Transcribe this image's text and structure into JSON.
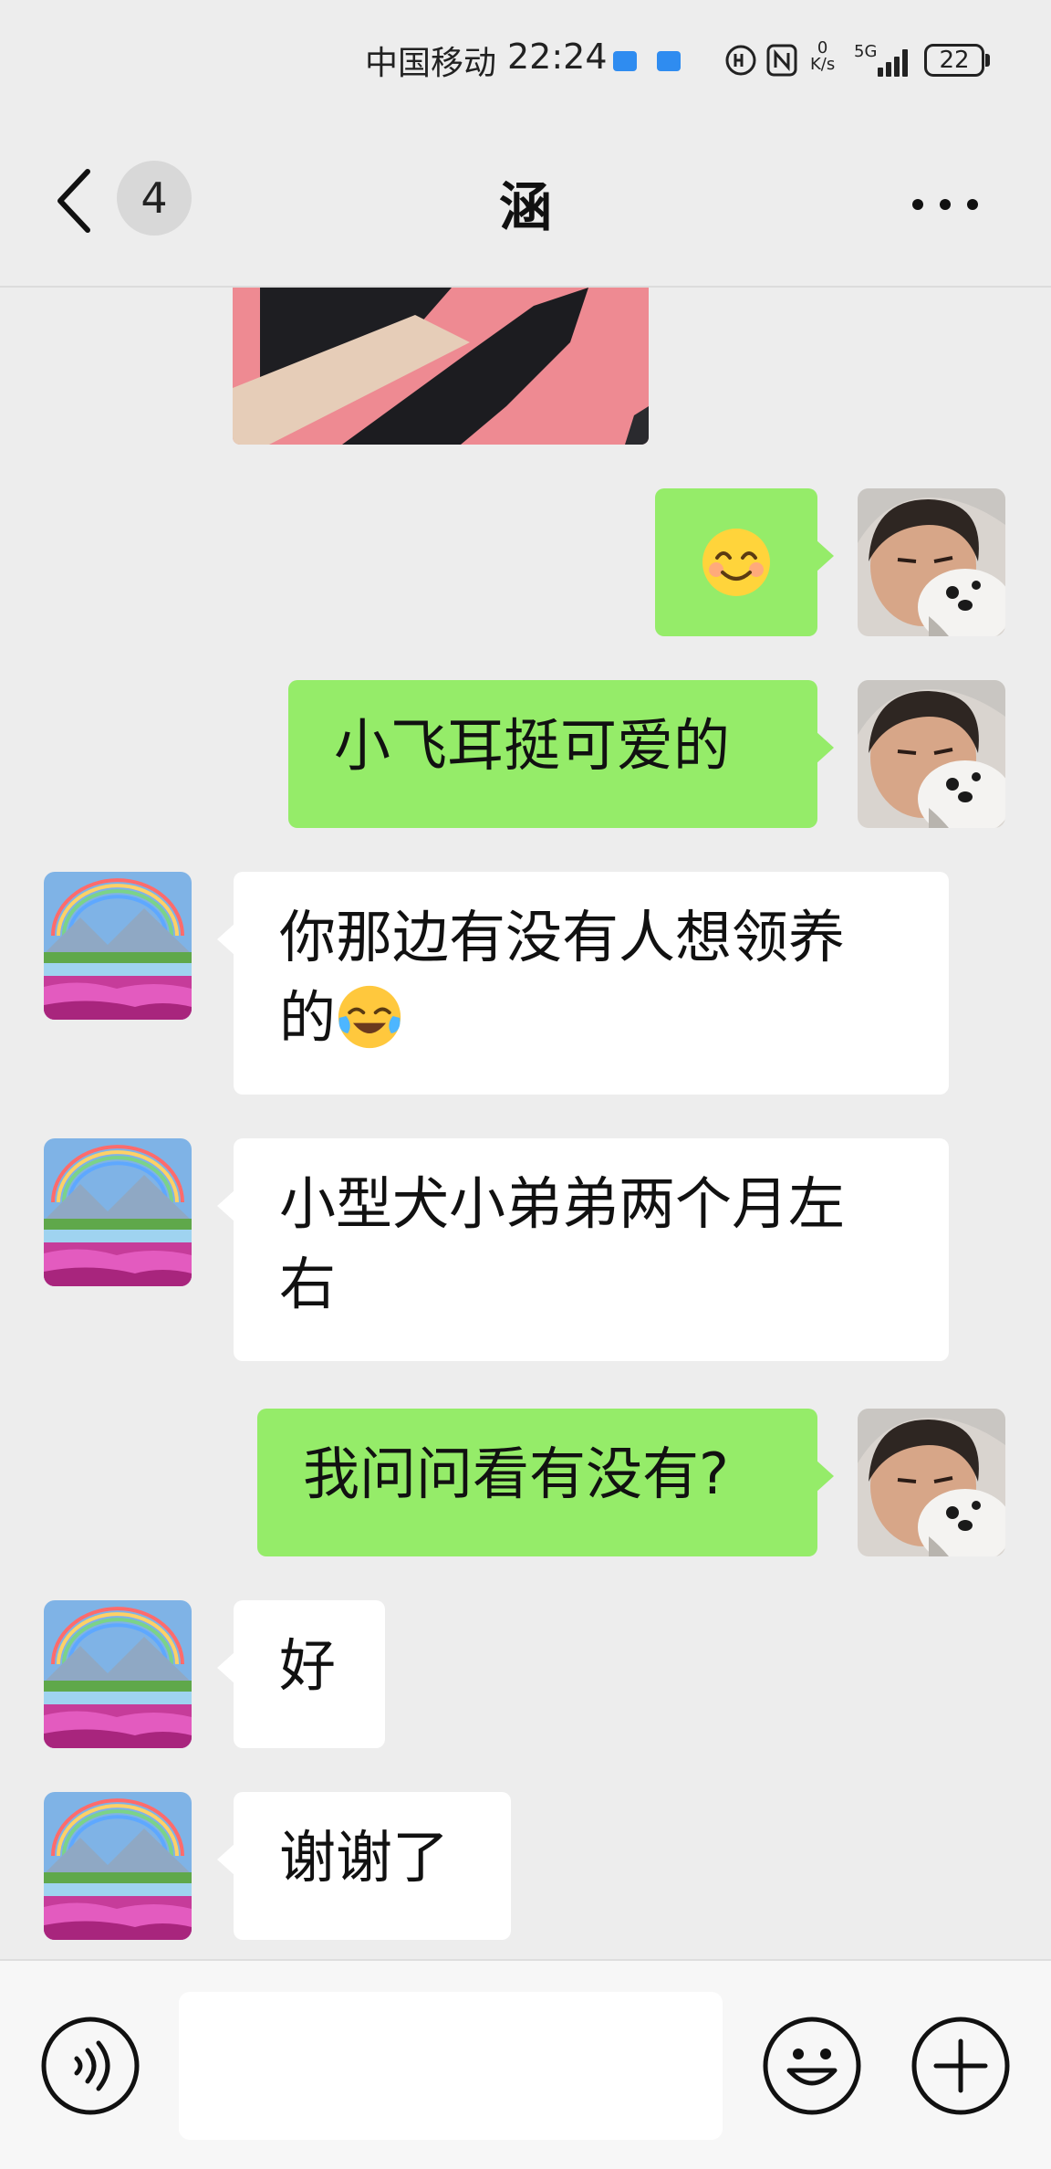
{
  "status_bar": {
    "carrier": "中国移动",
    "time": "22:24",
    "net_speed_value": "0",
    "net_speed_unit": "K/s",
    "network": "5G",
    "battery": "22"
  },
  "header": {
    "unread_count": "4",
    "title": "涵"
  },
  "messages": [
    {
      "id": "m1",
      "type": "emoji",
      "from": "me",
      "emoji": "😊"
    },
    {
      "id": "m2",
      "type": "text",
      "from": "me",
      "text": "小飞耳挺可爱的"
    },
    {
      "id": "m3",
      "type": "text",
      "from": "them",
      "line1": "你那边有没有人想领养",
      "line2": "的"
    },
    {
      "id": "m4",
      "type": "text",
      "from": "them",
      "line1": "小型犬小弟弟两个月左",
      "line2": "右"
    },
    {
      "id": "m5",
      "type": "text",
      "from": "me",
      "text": "我问问看有没有?"
    },
    {
      "id": "m6",
      "type": "text",
      "from": "them",
      "text": "好"
    },
    {
      "id": "m7",
      "type": "text",
      "from": "them",
      "text": "谢谢了"
    }
  ],
  "colors": {
    "background": "#ededed",
    "my_bubble": "#95ec69",
    "their_bubble": "#ffffff"
  },
  "input": {
    "value": "",
    "placeholder": ""
  }
}
